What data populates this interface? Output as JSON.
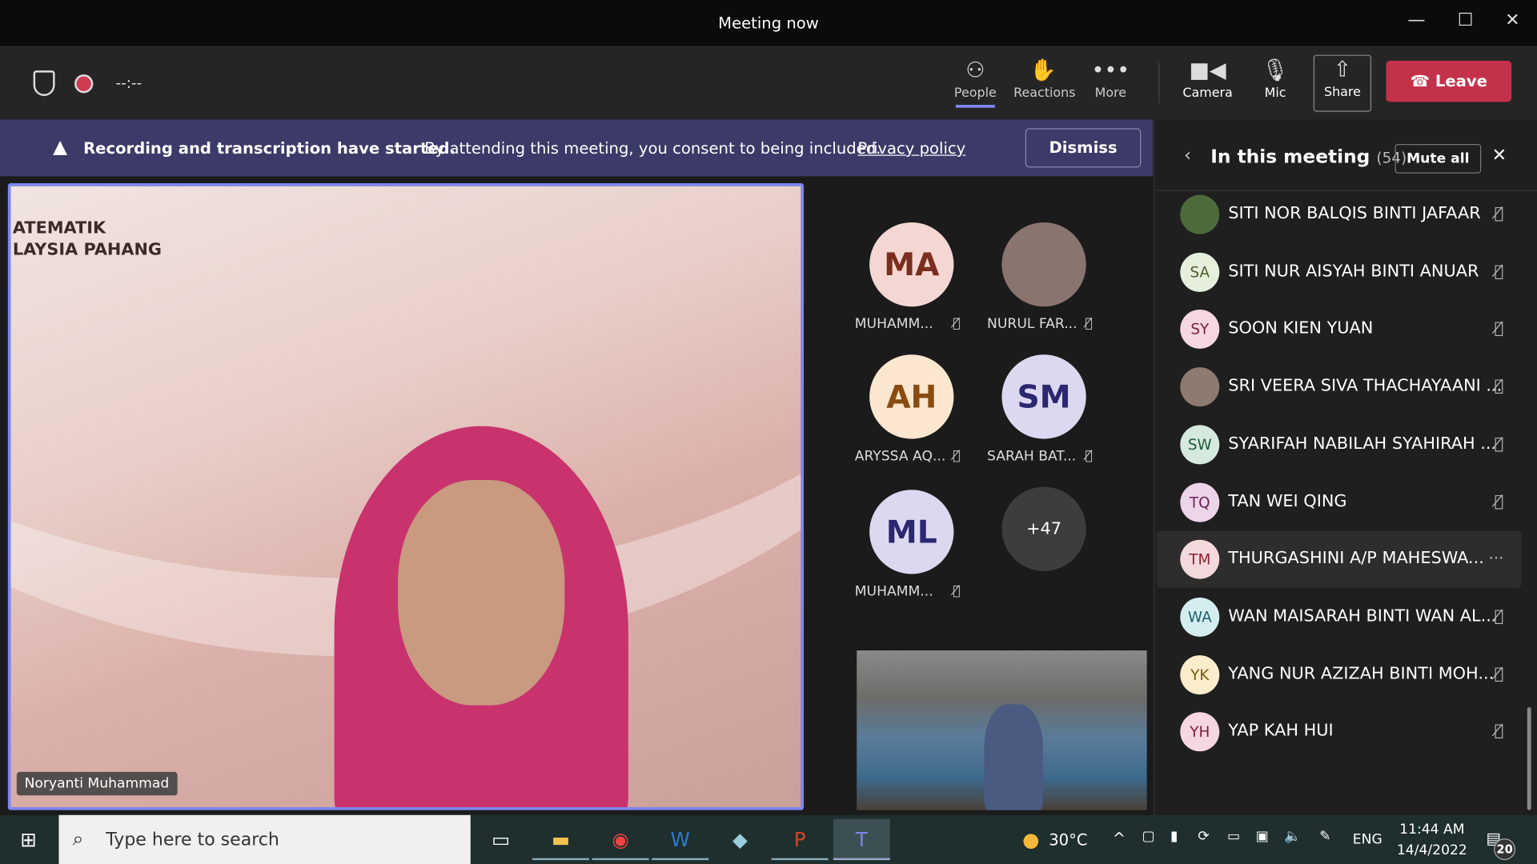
{
  "window": {
    "title": "Meeting now",
    "minimize": "—",
    "maximize": "☐",
    "close": "✕"
  },
  "toolbar": {
    "timer": "--:--",
    "people": "People",
    "reactions": "Reactions",
    "more": "More",
    "camera": "Camera",
    "mic": "Mic",
    "share": "Share",
    "leave": "Leave"
  },
  "banner": {
    "bold": "Recording and transcription have started.",
    "text": "By attending this meeting, you consent to being included.",
    "link": "Privacy policy",
    "dismiss": "Dismiss"
  },
  "stage": {
    "speaker": "Noryanti Muhammad",
    "slide_text_1": "ATEMATIK",
    "slide_text_2": "LAYSIA PAHANG"
  },
  "gallery": [
    {
      "initials": "MA",
      "name": "MUHAMM...",
      "bg": "#f4d7d2",
      "fg": "#7a2e1e"
    },
    {
      "initials": "",
      "name": "NURUL FAR...",
      "bg": "#8a7470",
      "fg": "#fff"
    },
    {
      "initials": "AH",
      "name": "ARYSSA AQ...",
      "bg": "#fbe6cf",
      "fg": "#8a4b10"
    },
    {
      "initials": "SM",
      "name": "SARAH BAT...",
      "bg": "#dcd8f0",
      "fg": "#2b2770"
    },
    {
      "initials": "ML",
      "name": "MUHAMM...",
      "bg": "#dcd8f0",
      "fg": "#2b2770"
    }
  ],
  "overflow": "+47",
  "panel": {
    "title": "In this meeting",
    "count": "(54)",
    "mute_all": "Mute all",
    "participants": [
      {
        "initials": "",
        "name": "SITI NOR BALQIS BINTI JAFAAR",
        "bg": "#4d6b3a",
        "fg": "#fff"
      },
      {
        "initials": "SA",
        "name": "SITI NUR AISYAH BINTI ANUAR",
        "bg": "#e6efdc",
        "fg": "#4b5e2a"
      },
      {
        "initials": "SY",
        "name": "SOON KIEN YUAN",
        "bg": "#f6d6e0",
        "fg": "#7a2040"
      },
      {
        "initials": "",
        "name": "SRI VEERA SIVA THACHAYAANI ...",
        "bg": "#8d7a70",
        "fg": "#fff"
      },
      {
        "initials": "SW",
        "name": "SYARIFAH NABILAH SYAHIRAH ...",
        "bg": "#d5e9de",
        "fg": "#1e5a3a"
      },
      {
        "initials": "TQ",
        "name": "TAN WEI QING",
        "bg": "#ecd5e8",
        "fg": "#6a1f5a"
      },
      {
        "initials": "TM",
        "name": "THURGASHINI A/P MAHESWA...",
        "bg": "#f4d9dc",
        "fg": "#8a2030"
      },
      {
        "initials": "WA",
        "name": "WAN MAISARAH BINTI WAN AL...",
        "bg": "#d4eef0",
        "fg": "#1c6068"
      },
      {
        "initials": "YK",
        "name": "YANG NUR AZIZAH BINTI MOH...",
        "bg": "#fbeccb",
        "fg": "#7a5a10"
      },
      {
        "initials": "YH",
        "name": "YAP KAH HUI",
        "bg": "#f6d6e0",
        "fg": "#7a2040"
      }
    ]
  },
  "taskbar": {
    "search_placeholder": "Type here to search",
    "weather": "30°C",
    "language": "ENG",
    "time": "11:44 AM",
    "date": "14/4/2022",
    "notifications": "20"
  },
  "colors": {
    "accent": "#7f85f5",
    "leave": "#c4314b",
    "banner": "#3b3a68"
  }
}
